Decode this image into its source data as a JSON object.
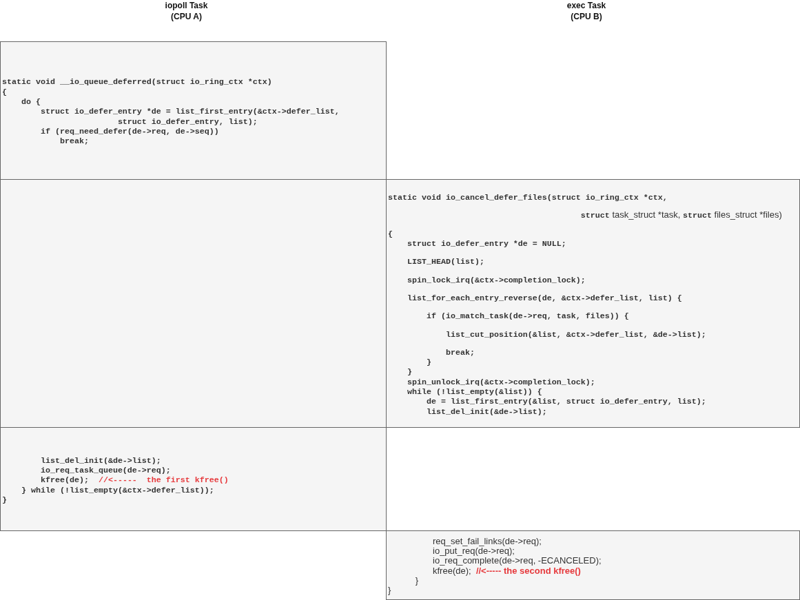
{
  "lanes": [
    {
      "title": "iopoll Task",
      "subtitle": "(CPU A)"
    },
    {
      "title": "exec Task",
      "subtitle": "(CPU B)"
    }
  ],
  "steps": [
    {
      "cpu_a": {
        "kind": "code",
        "blocks": [
          [
            [
              {
                "kind": "code",
                "text": "static void __io_queue_deferred(struct io_ring_ctx *ctx)"
              }
            ],
            [
              {
                "kind": "code",
                "text": "{"
              }
            ],
            [
              {
                "kind": "code",
                "text": "    do {"
              }
            ],
            [
              {
                "kind": "code",
                "text": "        struct io_defer_entry *de = list_first_entry(&ctx->defer_list,"
              }
            ],
            [
              {
                "kind": "code",
                "text": "                        struct io_defer_entry, list);"
              }
            ],
            [
              {
                "kind": "code",
                "text": "        if (req_need_defer(de->req, de->seq))"
              }
            ],
            [
              {
                "kind": "code",
                "text": "            break;"
              }
            ]
          ]
        ]
      }
    },
    {
      "cpu_a": {
        "kind": "empty"
      },
      "cpu_b": {
        "kind": "code",
        "blocks": [
          [
            [
              {
                "kind": "code",
                "text": "static void io_cancel_defer_files(struct io_ring_ctx *ctx,"
              }
            ]
          ],
          [
            [
              {
                "kind": "code",
                "text": "                                        struct"
              },
              {
                "kind": "text",
                "text": " task_struct *task, "
              },
              {
                "kind": "code",
                "text": "struct"
              },
              {
                "kind": "text",
                "text": " files_struct *files)"
              }
            ]
          ],
          [
            [
              {
                "kind": "code",
                "text": "{"
              }
            ],
            [
              {
                "kind": "code",
                "text": "    struct io_defer_entry *de = NULL;"
              }
            ]
          ],
          [
            [
              {
                "kind": "code",
                "text": "    LIST_HEAD(list);"
              }
            ]
          ],
          [
            [
              {
                "kind": "code",
                "text": "    spin_lock_irq(&ctx->completion_lock);"
              }
            ]
          ],
          [
            [
              {
                "kind": "code",
                "text": "    list_for_each_entry_reverse(de, &ctx->defer_list, list) {"
              }
            ]
          ],
          [
            [
              {
                "kind": "code",
                "text": "        if (io_match_task(de->req, task, files)) {"
              }
            ]
          ],
          [
            [
              {
                "kind": "code",
                "text": "            list_cut_position(&list, &ctx->defer_list, &de->list);"
              }
            ]
          ],
          [
            [
              {
                "kind": "code",
                "text": "            break;"
              }
            ],
            [
              {
                "kind": "code",
                "text": "        }"
              }
            ],
            [
              {
                "kind": "code",
                "text": "    }"
              }
            ],
            [
              {
                "kind": "code",
                "text": "    spin_unlock_irq(&ctx->completion_lock);"
              }
            ],
            [
              {
                "kind": "code",
                "text": "    while (!list_empty(&list)) {"
              }
            ],
            [
              {
                "kind": "code",
                "text": "        de = list_first_entry(&list, struct io_defer_entry, list);"
              }
            ],
            [
              {
                "kind": "code",
                "text": "        list_del_init(&de->list);"
              }
            ]
          ]
        ]
      }
    },
    {
      "cpu_a": {
        "kind": "code",
        "blocks": [
          [
            [
              {
                "kind": "code",
                "text": "        list_del_init(&de->list);"
              }
            ],
            [
              {
                "kind": "code",
                "text": "        io_req_task_queue(de->req);"
              }
            ],
            [
              {
                "kind": "code",
                "text": "        kfree(de);  "
              },
              {
                "kind": "code_comment",
                "text": "//<-----  the first kfree()"
              }
            ],
            [
              {
                "kind": "code",
                "text": "    } while (!list_empty(&ctx->defer_list));"
              }
            ],
            [
              {
                "kind": "code",
                "text": "}"
              }
            ]
          ]
        ]
      }
    },
    {
      "cpu_b": {
        "kind": "code",
        "blocks": [
          [
            [
              {
                "kind": "text",
                "text": "                  req_set_fail_links(de->req);"
              }
            ],
            [
              {
                "kind": "text",
                "text": "                  io_put_req(de->req);"
              }
            ],
            [
              {
                "kind": "text",
                "text": "                  io_req_complete(de->req, -ECANCELED);"
              }
            ],
            [
              {
                "kind": "text",
                "text": "                  kfree(de);  "
              },
              {
                "kind": "text_comment",
                "text": "//<----- the second kfree()"
              }
            ],
            [
              {
                "kind": "text",
                "text": "           }"
              }
            ],
            [
              {
                "kind": "text",
                "text": "}"
              }
            ]
          ]
        ]
      }
    }
  ]
}
